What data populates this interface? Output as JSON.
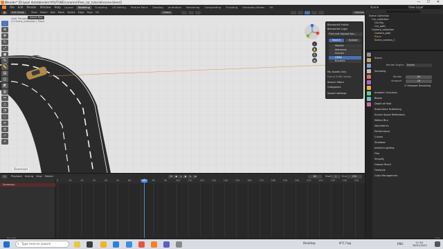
{
  "window": {
    "title": "Blender* [D:\\pool data\\blender\\YOUTUBE\\caramin\\Free_car_tutorial\\scene.blend]",
    "controls": [
      "—",
      "☐",
      "✕"
    ]
  },
  "menubar": {
    "menus": [
      "File",
      "Edit",
      "Render",
      "Window",
      "Help"
    ],
    "tabs": [
      "Layout",
      "Modeling",
      "Sculpting",
      "UV Editing",
      "Texture Paint",
      "Shading",
      "Animation",
      "Rendering",
      "Compositing",
      "Scripting",
      "Geometry Nodes",
      "UV"
    ],
    "active_tab": "Modeling",
    "scene": "Scene",
    "view_layer": "View Layer"
  },
  "viewport_header": {
    "mode": "Edit Mode",
    "menus": [
      "View",
      "Select",
      "Add",
      "Mesh",
      "Vertex",
      "Edge",
      "Face",
      "UV"
    ],
    "orientation": "Global",
    "options": "Options"
  },
  "viewport": {
    "view_label": "User Perspective",
    "collection_label": "(1) Scene_collection | Plane",
    "tool_header": [
      "Select Box"
    ],
    "gizmo_axes": [
      "X",
      "Y",
      "Z"
    ],
    "preview_text": "Download"
  },
  "popup": {
    "addon_title": "Blenderkit Profile",
    "login": "Blenderkit Login",
    "search_bar": "Find and Upload Ass...",
    "tabs": [
      "Search",
      "Upload"
    ],
    "categories": [
      "Models",
      "Materials",
      "Scenes",
      "HDRs",
      "Brushes"
    ],
    "active_category": "HDRs",
    "my_assets": "My Assets Only",
    "found": "Found 2280 results",
    "search_filters": "Search filters",
    "categories_label": "Categories",
    "import_settings": "Import settings"
  },
  "outliner": {
    "root": "Scene Collection",
    "items": [
      {
        "label": "Car_collection",
        "indent": 1
      },
      {
        "label": "Car Rig",
        "indent": 2
      },
      {
        "label": "Car_path",
        "indent": 2
      },
      {
        "label": "Camera_collection",
        "indent": 1
      },
      {
        "label": "Camera_path",
        "indent": 2
      },
      {
        "label": "Plane",
        "indent": 2
      },
      {
        "label": "Scene_camera_1",
        "indent": 2
      }
    ]
  },
  "properties": {
    "header": "Scene",
    "render_engine_label": "Render Engine",
    "render_engine": "Eevee",
    "sections": [
      "Sampling",
      "Render",
      "Viewport",
      "Viewport Denoising",
      "Ambient Occlusion",
      "Bloom",
      "Depth of Field",
      "Subsurface Scattering",
      "Screen Space Reflections",
      "Motion Blur",
      "Volumetrics",
      "Performance",
      "Curves",
      "Shadows",
      "Indirect Lighting",
      "Film",
      "Simplify",
      "Grease Pencil",
      "Freestyle",
      "Color Management"
    ],
    "render_samples": "64",
    "viewport_samples": "16"
  },
  "timeline": {
    "menus": [
      "Playback",
      "Keying",
      "View",
      "Marker"
    ],
    "summary": "Summary",
    "current_frame": "60",
    "start_label": "Start",
    "start": "1",
    "end_label": "End",
    "end": "250",
    "ticks": [
      "0",
      "10",
      "20",
      "30",
      "40",
      "50",
      "60",
      "70",
      "80",
      "90",
      "100",
      "110",
      "120",
      "130",
      "140",
      "150",
      "160",
      "170",
      "180",
      "190",
      "200",
      "210",
      "220",
      "230",
      "240",
      "250"
    ]
  },
  "status": {
    "left": "Pan View",
    "version": "3.3.1"
  },
  "taskbar": {
    "search_placeholder": "Type here to search",
    "desktop": "Desktop",
    "weather": "8°C Fog",
    "language": "ENG",
    "time": "11:34",
    "date": "26/01/2023"
  },
  "colors": {
    "accent": "#4772b3",
    "playhead": "#4a8fdd",
    "road": "#2b2b2b",
    "ground": "#e2e2e2",
    "car": "#b08a4a"
  }
}
